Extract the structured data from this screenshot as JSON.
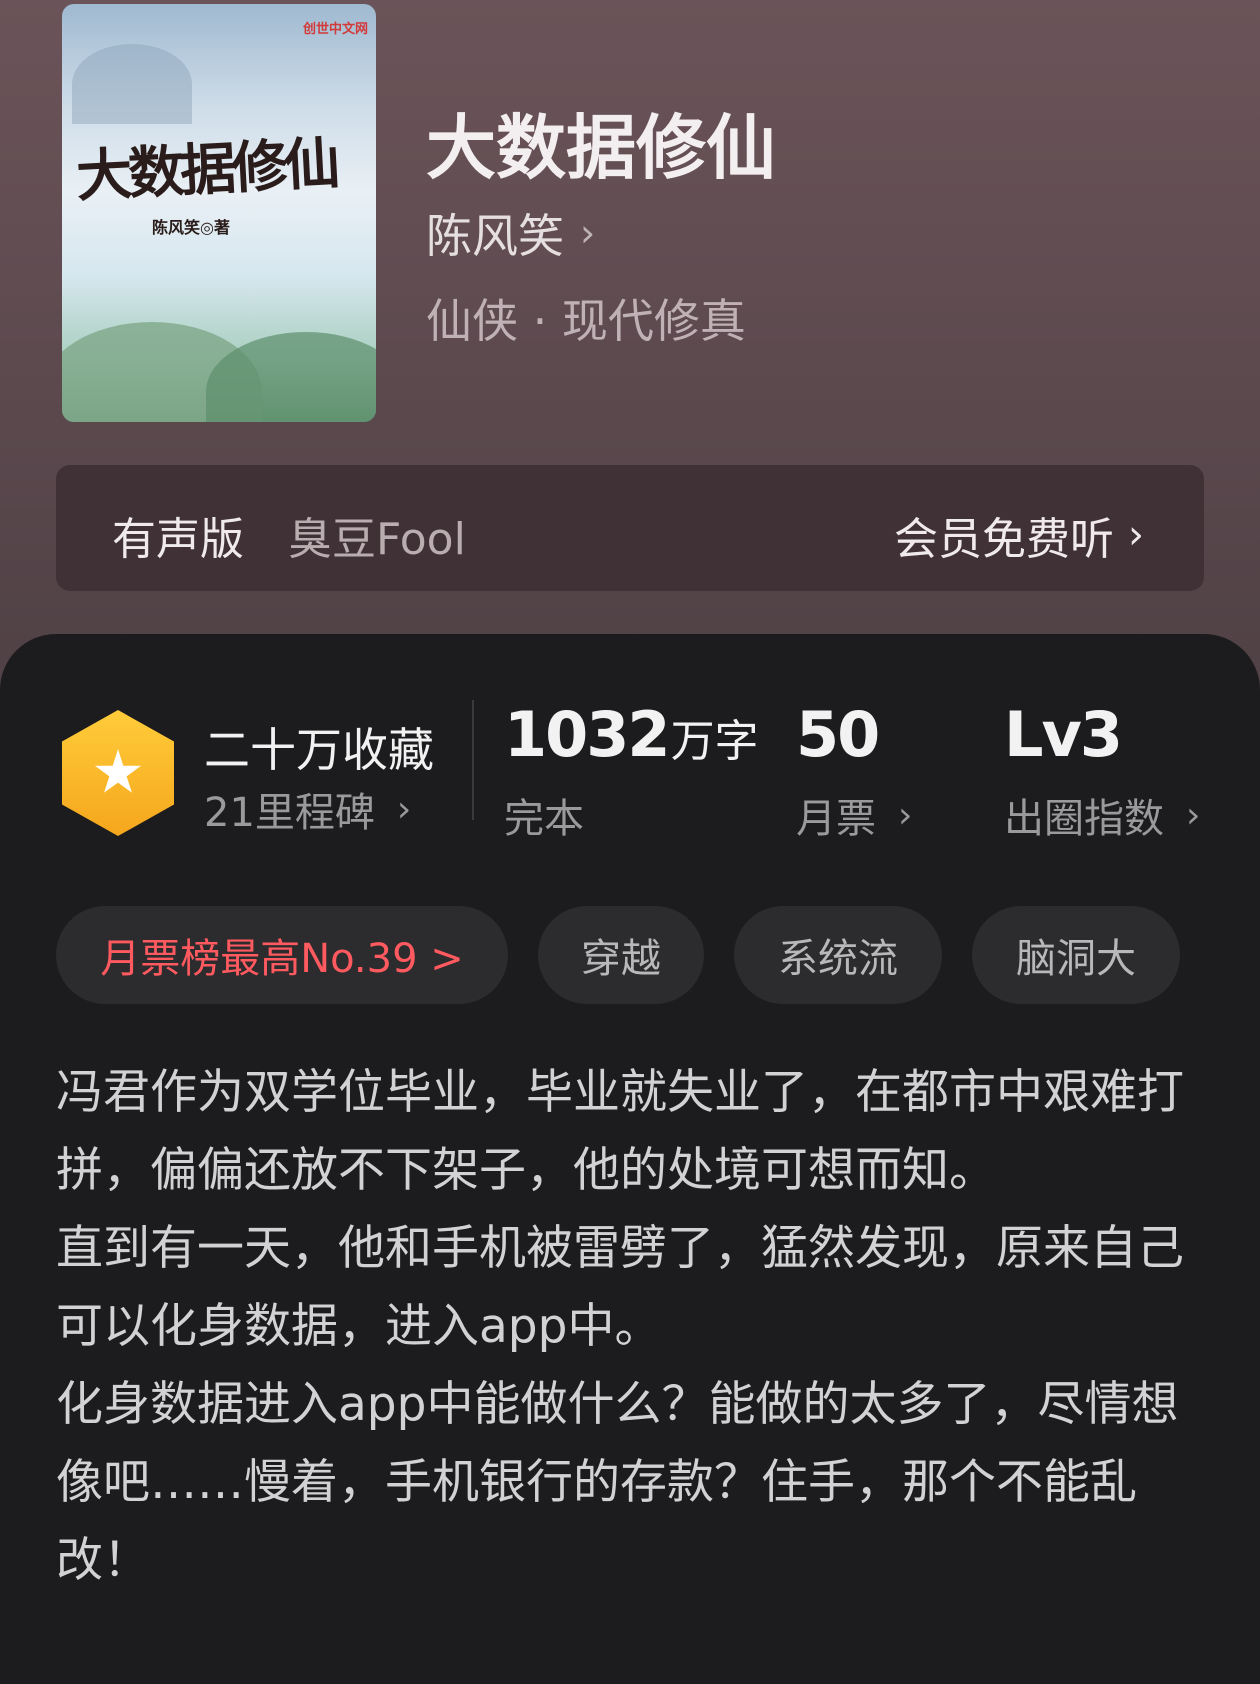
{
  "book": {
    "cover_title": "大数据修仙",
    "cover_author": "陈风笑◎著",
    "cover_publisher": "创世中文网",
    "title": "大数据修仙",
    "author": "陈风笑",
    "genre": "仙侠 · 现代修真"
  },
  "audio": {
    "label": "有声版",
    "narrator": "臭豆Fool",
    "link": "会员免费听"
  },
  "stats": {
    "collection_label": "二十万收藏",
    "milestone": "21里程碑",
    "word_count": "1032",
    "word_unit": "万字",
    "status": "完本",
    "monthly_votes": "50",
    "monthly_votes_label": "月票",
    "level": "Lv3",
    "level_label": "出圈指数"
  },
  "tags": [
    "月票榜最高No.39 >",
    "穿越",
    "系统流",
    "脑洞大"
  ],
  "synopsis": [
    "冯君作为双学位毕业，毕业就失业了，在都市中艰难打拼，偏偏还放不下架子，他的处境可想而知。",
    "直到有一天，他和手机被雷劈了，猛然发现，原来自己可以化身数据，进入app中。",
    "化身数据进入app中能做什么？能做的太多了，尽情想像吧……慢着，手机银行的存款？住手，那个不能乱改！"
  ],
  "colors": {
    "accent_red": "#ff5a5f",
    "badge_gold": "#f7b22a"
  }
}
